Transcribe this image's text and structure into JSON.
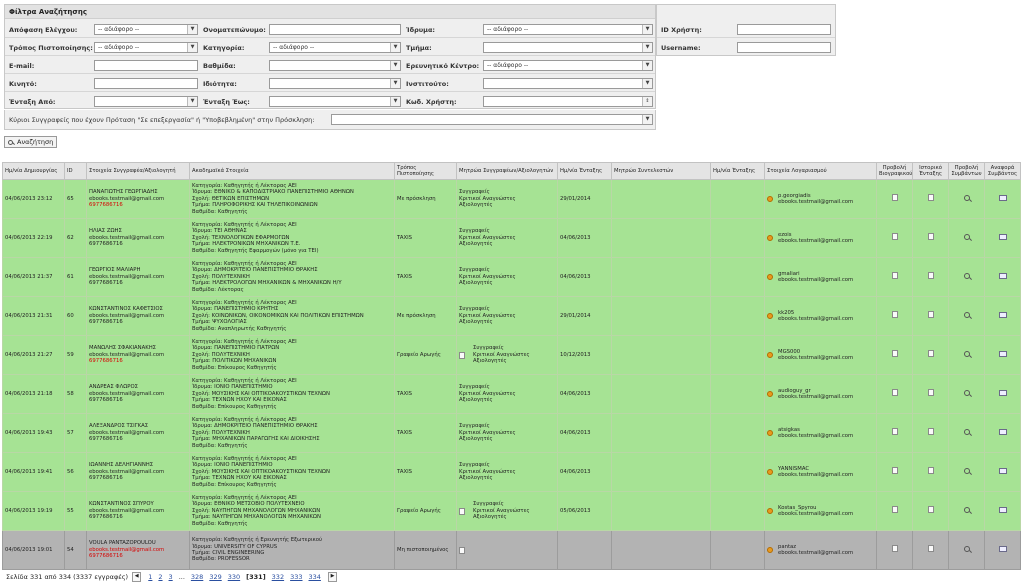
{
  "filters": {
    "title": "Φίλτρα Αναζήτησης",
    "labels": {
      "decision": "Απόφαση Ελέγχου:",
      "fullname": "Ονοματεπώνυμο:",
      "institution": "Ίδρυμα:",
      "user_id": "ID Χρήστη:",
      "cert_method": "Τρόπος Πιστοποίησης:",
      "category": "Κατηγορία:",
      "department": "Τμήμα:",
      "username": "Username:",
      "email": "E-mail:",
      "rank": "Βαθμίδα:",
      "research_center": "Ερευνητικό Κέντρο:",
      "mobile": "Κινητό:",
      "capacity": "Ιδιότητα:",
      "institute": "Ινστιτούτο:",
      "from": "Ένταξη Από:",
      "to": "Ένταξη Έως:",
      "user_code": "Κωδ. Χρήστη:",
      "main_authors": "Κύριοι Συγγραφείς που έχουν Πρόταση \"Σε επεξεργασία\" ή \"Υποβεβλημένη\" στην Πρόσκληση:"
    },
    "any_option": "-- αδιάφορο --",
    "search_button": "Αναζήτηση"
  },
  "table": {
    "headers": [
      "Ημ/νία Δημιουργίας",
      "ID",
      "Στοιχεία Συγγραφέα/Αξιολογητή",
      "Ακαδημαϊκά Στοιχεία",
      "Τρόπος Πιστοποίησης",
      "Μητρώα Συγγραφέων/Αξιολογητών",
      "Ημ/νία Ένταξης",
      "Μητρώο Συντελεστών",
      "Ημ/νία Ένταξης",
      "Στοιχεία Λογαριασμού",
      "Προβολή Βιογραφικού",
      "Ιστορικό Ένταξης",
      "Προβολή Συμβάντων",
      "Αναφορά Συμβάντος"
    ],
    "rows": [
      {
        "created": "04/06/2013 23:12",
        "id": "65",
        "name": "ΠΑΝΑΓΙΩΤΗΣ ΓΕΩΡΓΙΑΔΗΣ",
        "email": "ebooks.testmail@gmail.com",
        "phone": "6977686716",
        "phone_red": true,
        "academic": [
          "Κατηγορία: Καθηγητής ή Λέκτορας ΑΕΙ",
          "Ίδρυμα: ΕΘΝΙΚΟ & ΚΑΠΟΔΙΣΤΡΙΑΚΟ ΠΑΝΕΠΙΣΤΗΜΙΟ ΑΘΗΝΩΝ",
          "Σχολή: ΘΕΤΙΚΩΝ ΕΠΙΣΤΗΜΩΝ",
          "Τμήμα: ΠΛΗΡΟΦΟΡΙΚΗΣ ΚΑΙ ΤΗΛΕΠΙΚΟΙΝΩΝΙΩΝ",
          "Βαθμίδα: Καθηγητής"
        ],
        "cert": "Με πρόσκληση",
        "registries": [
          "Συγγραφείς",
          "Κριτικοί Αναγνώστες",
          "Αξιολογητές"
        ],
        "reg_doc": false,
        "join_date": "29/01/2014",
        "account_user": "p.georgiadis",
        "account_email": "ebooks.testmail@gmail.com",
        "grey": false
      },
      {
        "created": "04/06/2013 22:19",
        "id": "62",
        "name": "ΗΛΙΑΣ ΖΩΗΣ",
        "email": "ebooks.testmail@gmail.com",
        "phone": "6977686716",
        "phone_red": false,
        "academic": [
          "Κατηγορία: Καθηγητής ή Λέκτορας ΑΕΙ",
          "Ίδρυμα: ΤΕΙ ΑΘΗΝΑΣ",
          "Σχολή: ΤΕΧΝΟΛΟΓΙΚΩΝ ΕΦΑΡΜΟΓΩΝ",
          "Τμήμα: ΗΛΕΚΤΡΟΝΙΚΩΝ ΜΗΧΑΝΙΚΩΝ Τ.Ε.",
          "Βαθμίδα: Καθηγητής Εφαρμογών (μόνο για ΤΕΙ)"
        ],
        "cert": "TAXIS",
        "registries": [
          "Συγγραφείς",
          "Κριτικοί Αναγνώστες",
          "Αξιολογητές"
        ],
        "reg_doc": false,
        "join_date": "04/06/2013",
        "account_user": "ezois",
        "account_email": "ebooks.testmail@gmail.com",
        "grey": false
      },
      {
        "created": "04/06/2013 21:37",
        "id": "61",
        "name": "ΓΕΩΡΓΙΟΣ ΜΑΛΙΑΡΗ",
        "email": "ebooks.testmail@gmail.com",
        "phone": "6977686716",
        "phone_red": false,
        "academic": [
          "Κατηγορία: Καθηγητής ή Λέκτορας ΑΕΙ",
          "Ίδρυμα: ΔΗΜΟΚΡΙΤΕΙΟ ΠΑΝΕΠΙΣΤΗΜΙΟ ΘΡΑΚΗΣ",
          "Σχολή: ΠΟΛΥΤΕΧΝΙΚΗ",
          "Τμήμα: ΗΛΕΚΤΡΟΛΟΓΩΝ ΜΗΧΑΝΙΚΩΝ & ΜΗΧΑΝΙΚΩΝ Η/Υ",
          "Βαθμίδα: Λέκτορας"
        ],
        "cert": "TAXIS",
        "registries": [
          "Συγγραφείς",
          "Κριτικοί Αναγνώστες",
          "Αξιολογητές"
        ],
        "reg_doc": false,
        "join_date": "04/06/2013",
        "account_user": "gmaliari",
        "account_email": "ebooks.testmail@gmail.com",
        "grey": false
      },
      {
        "created": "04/06/2013 21:31",
        "id": "60",
        "name": "ΚΩΝΣΤΑΝΤΙΝΟΣ ΚΑΦΕΤΣΙΟΣ",
        "email": "ebooks.testmail@gmail.com",
        "phone": "6977686716",
        "phone_red": false,
        "academic": [
          "Κατηγορία: Καθηγητής ή Λέκτορας ΑΕΙ",
          "Ίδρυμα: ΠΑΝΕΠΙΣΤΗΜΙΟ ΚΡΗΤΗΣ",
          "Σχολή: ΚΟΙΝΩΝΙΚΩΝ, ΟΙΚΟΝΟΜΙΚΩΝ ΚΑΙ ΠΟΛΙΤΙΚΩΝ ΕΠΙΣΤΗΜΩΝ",
          "Τμήμα: ΨΥΧΟΛΟΓΙΑΣ",
          "Βαθμίδα: Αναπληρωτής Καθηγητής"
        ],
        "cert": "Με πρόσκληση",
        "registries": [
          "Συγγραφείς",
          "Κριτικοί Αναγνώστες",
          "Αξιολογητές"
        ],
        "reg_doc": false,
        "join_date": "29/01/2014",
        "account_user": "kk205",
        "account_email": "ebooks.testmail@gmail.com",
        "grey": false
      },
      {
        "created": "04/06/2013 21:27",
        "id": "59",
        "name": "ΜΑΝΩΛΗΣ ΣΦΑΚΙΑΝΑΚΗΣ",
        "email": "ebooks.testmail@gmail.com",
        "phone": "6977686716",
        "phone_red": true,
        "academic": [
          "Κατηγορία: Καθηγητής ή Λέκτορας ΑΕΙ",
          "Ίδρυμα: ΠΑΝΕΠΙΣΤΗΜΙΟ ΠΑΤΡΩΝ",
          "Σχολή: ΠΟΛΥΤΕΧΝΙΚΗ",
          "Τμήμα: ΠΟΛΙΤΙΚΩΝ ΜΗΧΑΝΙΚΩΝ",
          "Βαθμίδα: Επίκουρος Καθηγητής"
        ],
        "cert": "Γραφείο Αρωγής",
        "registries": [
          "Συγγραφείς",
          "Κριτικοί Αναγνώστες",
          "Αξιολογητές"
        ],
        "reg_doc": true,
        "join_date": "10/12/2013",
        "account_user": "MGS000",
        "account_email": "ebooks.testmail@gmail.com",
        "grey": false
      },
      {
        "created": "04/06/2013 21:18",
        "id": "58",
        "name": "ΑΝΔΡΕΑΣ ΦΛΩΡΟΣ",
        "email": "ebooks.testmail@gmail.com",
        "phone": "6977686716",
        "phone_red": false,
        "academic": [
          "Κατηγορία: Καθηγητής ή Λέκτορας ΑΕΙ",
          "Ίδρυμα: ΙΟΝΙΟ ΠΑΝΕΠΙΣΤΗΜΙΟ",
          "Σχολή: ΜΟΥΣΙΚΗΣ ΚΑΙ ΟΠΤΙΚΟΑΚΟΥΣΤΙΚΩΝ ΤΕΧΝΩΝ",
          "Τμήμα: ΤΕΧΝΩΝ ΗΧΟΥ ΚΑΙ ΕΙΚΟΝΑΣ",
          "Βαθμίδα: Επίκουρος Καθηγητής"
        ],
        "cert": "TAXIS",
        "registries": [
          "Συγγραφείς",
          "Κριτικοί Αναγνώστες",
          "Αξιολογητές"
        ],
        "reg_doc": false,
        "join_date": "04/06/2013",
        "account_user": "audioguy_gr",
        "account_email": "ebooks.testmail@gmail.com",
        "grey": false
      },
      {
        "created": "04/06/2013 19:43",
        "id": "57",
        "name": "ΑΛΕΞΑΝΔΡΟΣ ΤΣΙΓΚΑΣ",
        "email": "ebooks.testmail@gmail.com",
        "phone": "6977686716",
        "phone_red": false,
        "academic": [
          "Κατηγορία: Καθηγητής ή Λέκτορας ΑΕΙ",
          "Ίδρυμα: ΔΗΜΟΚΡΙΤΕΙΟ ΠΑΝΕΠΙΣΤΗΜΙΟ ΘΡΑΚΗΣ",
          "Σχολή: ΠΟΛΥΤΕΧΝΙΚΗ",
          "Τμήμα: ΜΗΧΑΝΙΚΩΝ ΠΑΡΑΓΩΓΗΣ ΚΑΙ ΔΙΟΙΚΗΣΗΣ",
          "Βαθμίδα: Καθηγητής"
        ],
        "cert": "TAXIS",
        "registries": [
          "Συγγραφείς",
          "Κριτικοί Αναγνώστες",
          "Αξιολογητές"
        ],
        "reg_doc": false,
        "join_date": "04/06/2013",
        "account_user": "atsigkas",
        "account_email": "ebooks.testmail@gmail.com",
        "grey": false
      },
      {
        "created": "04/06/2013 19:41",
        "id": "56",
        "name": "ΙΩΑΝΝΗΣ ΔΕΛΗΓΙΑΝΝΗΣ",
        "email": "ebooks.testmail@gmail.com",
        "phone": "6977686716",
        "phone_red": false,
        "academic": [
          "Κατηγορία: Καθηγητής ή Λέκτορας ΑΕΙ",
          "Ίδρυμα: ΙΟΝΙΟ ΠΑΝΕΠΙΣΤΗΜΙΟ",
          "Σχολή: ΜΟΥΣΙΚΗΣ ΚΑΙ ΟΠΤΙΚΟΑΚΟΥΣΤΙΚΩΝ ΤΕΧΝΩΝ",
          "Τμήμα: ΤΕΧΝΩΝ ΗΧΟΥ ΚΑΙ ΕΙΚΟΝΑΣ",
          "Βαθμίδα: Επίκουρος Καθηγητής"
        ],
        "cert": "TAXIS",
        "registries": [
          "Συγγραφείς",
          "Κριτικοί Αναγνώστες",
          "Αξιολογητές"
        ],
        "reg_doc": false,
        "join_date": "04/06/2013",
        "account_user": "YANNISMAC",
        "account_email": "ebooks.testmail@gmail.com",
        "grey": false
      },
      {
        "created": "04/06/2013 19:19",
        "id": "55",
        "name": "ΚΩΝΣΤΑΝΤΙΝΟΣ ΣΠΥΡΟΥ",
        "email": "ebooks.testmail@gmail.com",
        "phone": "6977686716",
        "phone_red": false,
        "academic": [
          "Κατηγορία: Καθηγητής ή Λέκτορας ΑΕΙ",
          "Ίδρυμα: ΕΘΝΙΚΟ ΜΕΤΣΟΒΙΟ ΠΟΛΥΤΕΧΝΕΙΟ",
          "Σχολή: ΝΑΥΠΗΓΩΝ ΜΗΧΑΝΟΛΟΓΩΝ ΜΗΧΑΝΙΚΩΝ",
          "Τμήμα: ΝΑΥΠΗΓΩΝ ΜΗΧΑΝΟΛΟΓΩΝ ΜΗΧΑΝΙΚΩΝ",
          "Βαθμίδα: Καθηγητής"
        ],
        "cert": "Γραφείο Αρωγής",
        "registries": [
          "Συγγραφείς",
          "Κριτικοί Αναγνώστες",
          "Αξιολογητές"
        ],
        "reg_doc": true,
        "join_date": "05/06/2013",
        "account_user": "Kostas_Spyrou",
        "account_email": "ebooks.testmail@gmail.com",
        "grey": false
      },
      {
        "created": "04/06/2013 19:01",
        "id": "54",
        "name": "VOULA PANTAZOPOULOU",
        "email": "ebooks.testmail@gmail.com",
        "phone": "6977686716",
        "phone_red": true,
        "email_red": true,
        "academic": [
          "Κατηγορία: Καθηγητής ή Ερευνητής Εξωτερικού",
          "Ίδρυμα: UNIVERSITY OF CYPRUS",
          "Τμήμα: CIVIL ENGINEERING",
          "Βαθμίδα: PROFESSOR"
        ],
        "cert": "Μη πιστοποιημένος",
        "registries": [],
        "reg_doc": true,
        "join_date": "",
        "account_user": "pantaz",
        "account_email": "ebooks.testmail@gmail.com",
        "grey": true
      }
    ]
  },
  "pager": {
    "summary": "Σελίδα 331 από 334 (3337 εγγραφές)",
    "pages": [
      "1",
      "2",
      "3",
      "...",
      "328",
      "329",
      "330",
      "[331]",
      "332",
      "333",
      "334"
    ],
    "current": "[331]"
  }
}
